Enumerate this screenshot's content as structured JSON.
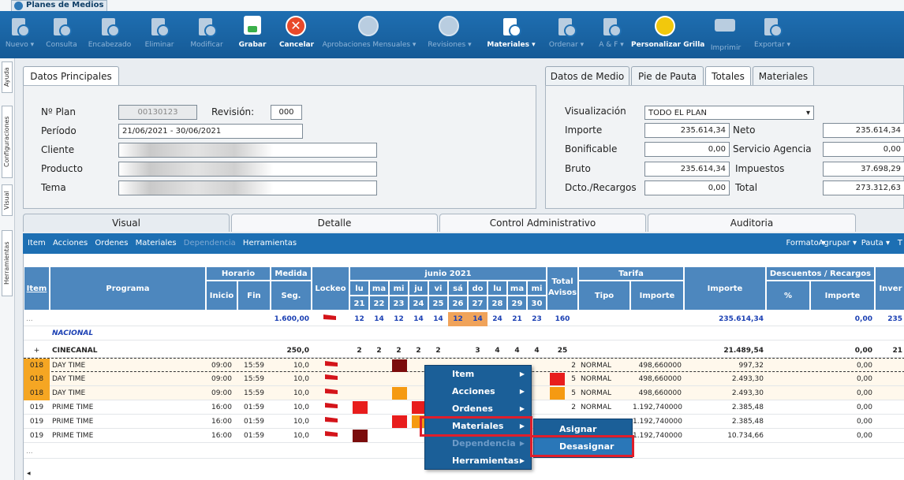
{
  "app": {
    "title": "Planes de Medios"
  },
  "toolbar": [
    {
      "label": "Nuevo",
      "dropdown": true,
      "enabled": false,
      "icon": "new-doc-icon"
    },
    {
      "label": "Consulta",
      "enabled": false,
      "icon": "query-doc-icon"
    },
    {
      "label": "Encabezado",
      "enabled": false,
      "icon": "header-edit-icon"
    },
    {
      "label": "Eliminar",
      "enabled": false,
      "icon": "delete-doc-icon"
    },
    {
      "label": "Modificar",
      "enabled": false,
      "icon": "modify-doc-icon"
    },
    {
      "label": "Grabar",
      "enabled": true,
      "icon": "save-icon"
    },
    {
      "label": "Cancelar",
      "enabled": true,
      "icon": "cancel-icon"
    },
    {
      "label": "Aprobaciones Mensuales",
      "dropdown": true,
      "enabled": false,
      "icon": "approval-icon"
    },
    {
      "label": "Revisiones",
      "dropdown": true,
      "enabled": false,
      "icon": "review-icon"
    },
    {
      "label": "Materiales",
      "dropdown": true,
      "enabled": true,
      "icon": "materials-icon"
    },
    {
      "label": "Ordenar",
      "dropdown": true,
      "enabled": false,
      "icon": "sort-icon"
    },
    {
      "label": "A & F",
      "dropdown": true,
      "enabled": false,
      "icon": "af-icon"
    },
    {
      "label": "Personalizar Grilla",
      "enabled": true,
      "icon": "grid-customize-icon"
    },
    {
      "label": "Imprimir",
      "enabled": false,
      "icon": "print-icon"
    },
    {
      "label": "Exportar",
      "dropdown": true,
      "enabled": false,
      "icon": "export-icon"
    }
  ],
  "sidebar": [
    "Ayuda",
    "Configuraciones",
    "Visual",
    "Herramientas"
  ],
  "datos": {
    "tab": "Datos Principales",
    "plan_label": "Nº Plan",
    "plan": "00130123",
    "revision_label": "Revisión:",
    "revision": "000",
    "periodo_label": "Período",
    "periodo": "21/06/2021 - 30/06/2021",
    "cliente_label": "Cliente",
    "producto_label": "Producto",
    "tema_label": "Tema"
  },
  "right": {
    "tabs": [
      "Datos de Medio",
      "Pie de Pauta",
      "Totales",
      "Materiales"
    ],
    "active": "Totales",
    "visualizacion_label": "Visualización",
    "visualizacion": "TODO EL PLAN",
    "importe_label": "Importe",
    "importe": "235.614,34",
    "neto_label": "Neto",
    "neto": "235.614,34",
    "bonificable_label": "Bonificable",
    "bonificable": "0,00",
    "servicio_label": "Servicio Agencia",
    "servicio": "0,00",
    "bruto_label": "Bruto",
    "bruto": "235.614,34",
    "impuestos_label": "Impuestos",
    "impuestos": "37.698,29",
    "dcto_label": "Dcto./Recargos",
    "dcto": "0,00",
    "total_label": "Total",
    "total": "273.312,63"
  },
  "workspace_tabs": [
    "Visual",
    "Detalle",
    "Control Administrativo",
    "Auditoria"
  ],
  "menubar": {
    "left": [
      "Item",
      "Acciones",
      "Ordenes",
      "Materiales",
      "Dependencia",
      "Herramientas"
    ],
    "right": [
      "Formato ▾",
      "Agrupar ▾",
      "Pauta ▾",
      "T"
    ]
  },
  "grid": {
    "headers": {
      "item": "Item",
      "programa": "Programa",
      "horario": "Horario",
      "inicio": "Inicio",
      "fin": "Fin",
      "medida": "Medida",
      "seg": "Seg.",
      "lockeo": "Lockeo",
      "month": "junio 2021",
      "total_avisos": "Total Avisos",
      "tarifa": "Tarifa",
      "tipo": "Tipo",
      "importe": "Importe",
      "importe2": "Importe",
      "descuentos": "Descuentos / Recargos",
      "pct": "%",
      "importe3": "Importe",
      "inver": "Inver"
    },
    "days": [
      "lu",
      "ma",
      "mi",
      "ju",
      "vi",
      "sá",
      "do",
      "lu",
      "ma",
      "mi"
    ],
    "dates": [
      "21",
      "22",
      "23",
      "24",
      "25",
      "26",
      "27",
      "28",
      "29",
      "30"
    ],
    "totals_row": {
      "item": "...",
      "medida": "1.600,00",
      "days": [
        "12",
        "14",
        "12",
        "14",
        "14",
        "12",
        "14",
        "24",
        "21",
        "23"
      ],
      "total": "160",
      "importe": "235.614,34",
      "desc": "0,00",
      "inver": "235"
    },
    "group": "NACIONAL",
    "subgroup": {
      "item": "+",
      "programa": "CINECANAL",
      "medida": "250,0",
      "days": [
        "2",
        "2",
        "2",
        "2",
        "2",
        "",
        "3",
        "4",
        "4",
        "4"
      ],
      "total": "25",
      "importe": "21.489,54",
      "desc": "0,00",
      "inver": "21"
    },
    "rows": [
      {
        "item": "018",
        "programa": "DAY TIME",
        "inicio": "09:00",
        "fin": "15:59",
        "seg": "10,0",
        "total": "2",
        "tipo": "NORMAL",
        "tarifa": "498,660000",
        "importe": "997,32",
        "desc": "0,00"
      },
      {
        "item": "018",
        "programa": "DAY TIME",
        "inicio": "09:00",
        "fin": "15:59",
        "seg": "10,0",
        "total": "5",
        "tipo": "NORMAL",
        "tarifa": "498,660000",
        "importe": "2.493,30",
        "desc": "0,00"
      },
      {
        "item": "018",
        "programa": "DAY TIME",
        "inicio": "09:00",
        "fin": "15:59",
        "seg": "10,0",
        "total": "5",
        "tipo": "NORMAL",
        "tarifa": "498,660000",
        "importe": "2.493,30",
        "desc": "0,00"
      },
      {
        "item": "019",
        "programa": "PRIME TIME",
        "inicio": "16:00",
        "fin": "01:59",
        "seg": "10,0",
        "total": "2",
        "tipo": "NORMAL",
        "tarifa": "1.192,740000",
        "importe": "2.385,48",
        "desc": "0,00"
      },
      {
        "item": "019",
        "programa": "PRIME TIME",
        "inicio": "16:00",
        "fin": "01:59",
        "seg": "10,0",
        "total": "",
        "tipo": "",
        "tarifa": "1.192,740000",
        "importe": "2.385,48",
        "desc": "0,00"
      },
      {
        "item": "019",
        "programa": "PRIME TIME",
        "inicio": "16:00",
        "fin": "01:59",
        "seg": "10,0",
        "total": "",
        "tipo": "",
        "tarifa": "1.192,740000",
        "importe": "10.734,66",
        "desc": "0,00"
      }
    ],
    "ellipsis": "..."
  },
  "context_menu": {
    "items": [
      "Item",
      "Acciones",
      "Ordenes",
      "Materiales",
      "Dependencia",
      "Herramientas"
    ],
    "submenu": [
      "Asignar",
      "Desasignar"
    ]
  }
}
